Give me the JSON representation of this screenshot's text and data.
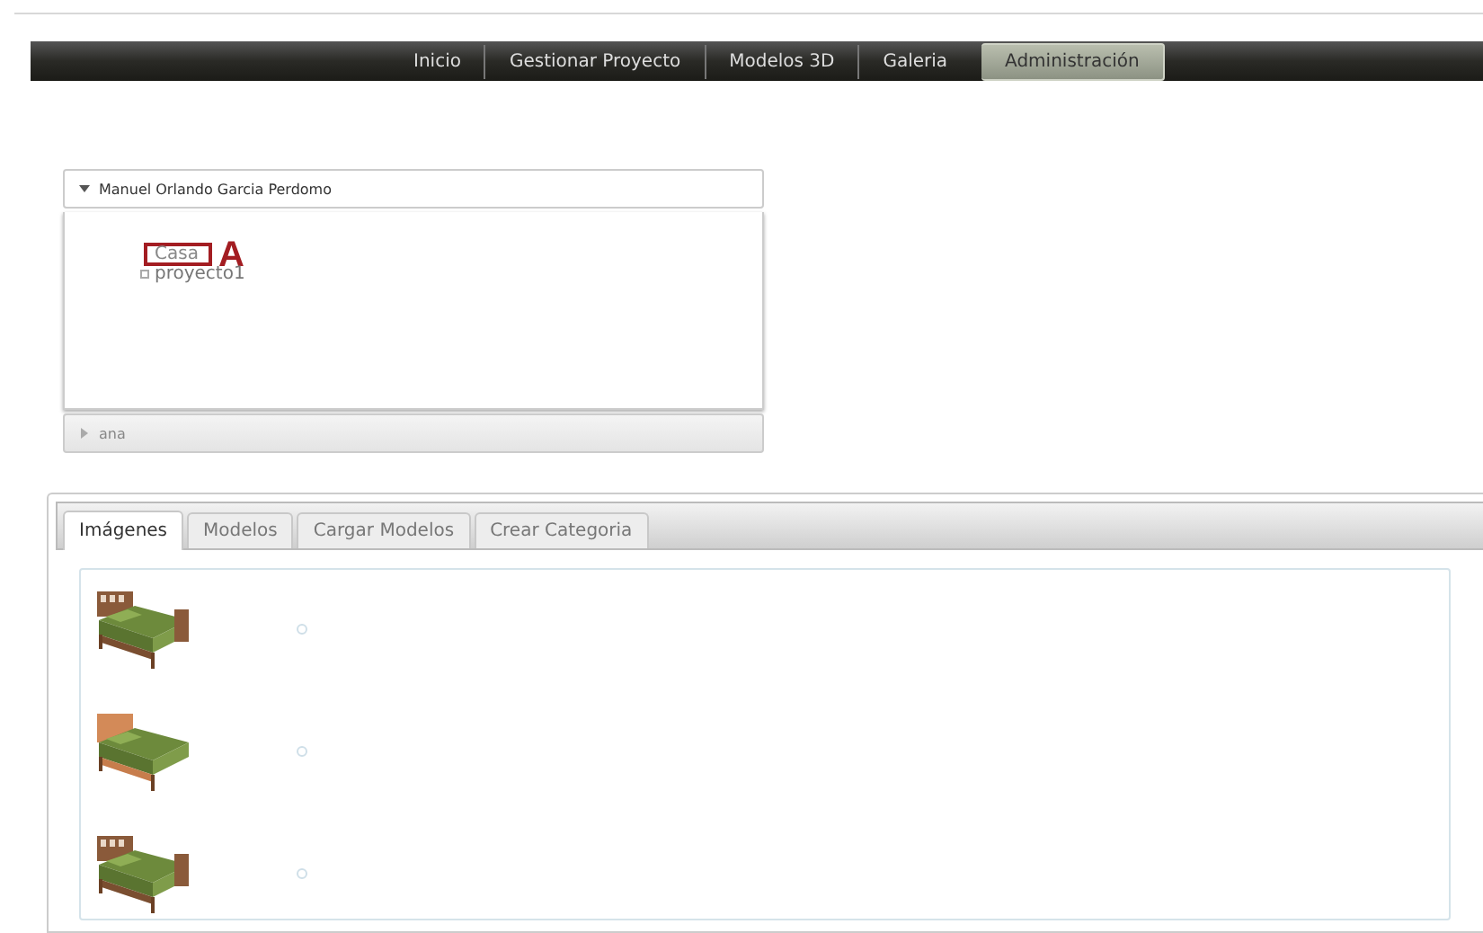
{
  "nav": {
    "items": [
      {
        "label": "Inicio",
        "selected": false
      },
      {
        "label": "Gestionar Proyecto",
        "selected": false
      },
      {
        "label": "Modelos 3D",
        "selected": false
      },
      {
        "label": "Galeria",
        "selected": false
      },
      {
        "label": "Administración",
        "selected": true
      }
    ]
  },
  "accordion": [
    {
      "title": "Manuel Orlando Garcia Perdomo",
      "expanded": true,
      "tree": [
        {
          "label": "Casa",
          "marked": true,
          "annotation": "A"
        },
        {
          "label": "proyecto1",
          "marked": false
        }
      ]
    },
    {
      "title": "ana",
      "expanded": false
    }
  ],
  "tabs": [
    {
      "label": "Imágenes",
      "selected": true
    },
    {
      "label": "Modelos",
      "selected": false
    },
    {
      "label": "Cargar Modelos",
      "selected": false
    },
    {
      "label": "Crear Categoria",
      "selected": false
    }
  ],
  "images": [
    {
      "kind": "slatted"
    },
    {
      "kind": "padded"
    },
    {
      "kind": "slatted"
    }
  ]
}
